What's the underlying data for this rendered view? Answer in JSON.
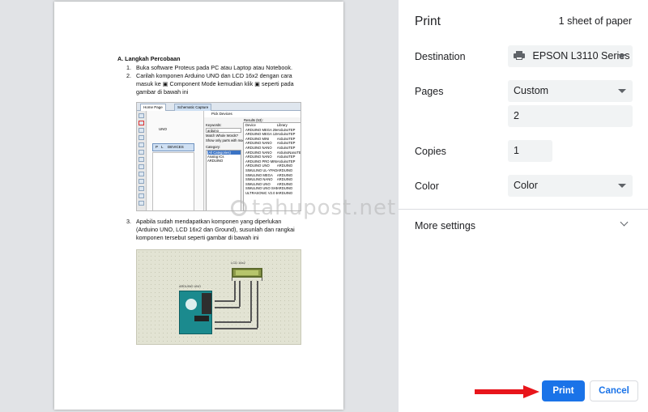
{
  "preview": {
    "doc": {
      "heading": "A.  Langkah Percobaan",
      "steps": [
        {
          "num": "1.",
          "text": "Buka software Proteus pada PC atau Laptop atau Notebook."
        },
        {
          "num": "2.",
          "text": "Carilah komponen Arduino UNO dan LCD 16x2 dengan cara masuk ke ▣ Component  Mode kemudian klik ▣ seperti pada gambar di bawah ini"
        },
        {
          "num": "3.",
          "text": "Apabila sudah mendapatkan komponen yang diperlukan (Arduino UNO, LCD 16x2 dan Ground), susunlah dan rangkai komponen tersebut seperti gambar di bawah ini"
        }
      ]
    },
    "shot1": {
      "tab_home": "Home Page",
      "tab_schematic": "Schematic Capture",
      "left_label_p": "P",
      "left_label_l": "L",
      "devices_label": "DEVICES",
      "uno_label": "UNO",
      "dialog_title": "Pick Devices",
      "keywords_label": "Keywords:",
      "keywords_value": "arduino",
      "match_label": "Match Whole Words?",
      "show_only_label": "Show only parts with models?",
      "category_label": "Category:",
      "categories": [
        "(All Categories)",
        "Analog ICs",
        "ARDUINO"
      ],
      "results_label": "Results (53):",
      "results_col_device": "Device",
      "results_col_library": "Library",
      "results": [
        [
          "ARDUINO MEGA 2560",
          "ArduinoTEP"
        ],
        [
          "ARDUINO MEGA 1280",
          "ArduinoTEP"
        ],
        [
          "ARDUINO MINI",
          "ArduinoTEP"
        ],
        [
          "ARDUINO NANO",
          "ArduinoTEP"
        ],
        [
          "ARDUINO NANO",
          "ArduinoTEP"
        ],
        [
          "ARDUINO NANO",
          "ArduinoNanoTEP"
        ],
        [
          "ARDUINO NANO",
          "ArduinoTEP"
        ],
        [
          "ARDUINO PRO MINI",
          "ArduinoTEP"
        ],
        [
          "ARDUINO UNO",
          "ARDUINO"
        ],
        [
          "SIMULINO UL-YPAD",
          "ARDUINO"
        ],
        [
          "SIMULINO MEGA",
          "ARDUINO"
        ],
        [
          "SIMULINO NANO",
          "ARDUINO"
        ],
        [
          "SIMULINO UNO",
          "ARDUINO"
        ],
        [
          "SIMULINO UNO SHD",
          "ARDUINO"
        ],
        [
          "ULTRASONIC V2.0 B",
          "ARDUINO"
        ]
      ]
    },
    "shot2": {
      "lcd_label": "LCD 16x2",
      "uno_label": "ARDUINO UNO"
    },
    "watermark": "tahupost.net"
  },
  "panel": {
    "title": "Print",
    "sheets": "1 sheet of paper",
    "destination_label": "Destination",
    "destination_value": "EPSON L3110 Series",
    "pages_label": "Pages",
    "pages_value": "Custom",
    "pages_custom": "2",
    "copies_label": "Copies",
    "copies_value": "1",
    "color_label": "Color",
    "color_value": "Color",
    "more_settings": "More settings",
    "print_button": "Print",
    "cancel_button": "Cancel"
  },
  "colors": {
    "accent": "#1a73e8",
    "arrow": "#e8151b",
    "preview_bg": "#e1e3e6",
    "field_bg": "#f1f3f4"
  }
}
